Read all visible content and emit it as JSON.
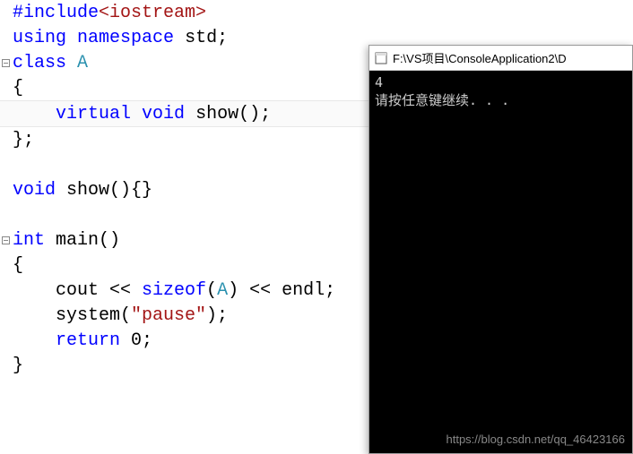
{
  "editor": {
    "lines": [
      {
        "fold": "",
        "tokens": [
          {
            "t": "#include",
            "c": "preproc"
          },
          {
            "t": "<iostream>",
            "c": "angle"
          }
        ]
      },
      {
        "fold": "",
        "tokens": [
          {
            "t": "using",
            "c": "kw-blue"
          },
          {
            "t": " ",
            "c": "txt"
          },
          {
            "t": "namespace",
            "c": "kw-blue"
          },
          {
            "t": " std;",
            "c": "txt"
          }
        ]
      },
      {
        "fold": "minus",
        "tokens": [
          {
            "t": "class",
            "c": "kw-blue"
          },
          {
            "t": " ",
            "c": "txt"
          },
          {
            "t": "A",
            "c": "kw-teal"
          }
        ]
      },
      {
        "fold": "",
        "tokens": [
          {
            "t": "{",
            "c": "txt"
          }
        ]
      },
      {
        "fold": "",
        "highlight": true,
        "tokens": [
          {
            "t": "    ",
            "c": "txt"
          },
          {
            "t": "virtual",
            "c": "kw-blue"
          },
          {
            "t": " ",
            "c": "txt"
          },
          {
            "t": "void",
            "c": "kw-blue"
          },
          {
            "t": " show();",
            "c": "txt"
          }
        ]
      },
      {
        "fold": "",
        "tokens": [
          {
            "t": "};",
            "c": "txt"
          }
        ]
      },
      {
        "fold": "",
        "tokens": []
      },
      {
        "fold": "",
        "tokens": [
          {
            "t": "void",
            "c": "kw-blue"
          },
          {
            "t": " show(){}",
            "c": "txt"
          }
        ]
      },
      {
        "fold": "",
        "tokens": []
      },
      {
        "fold": "minus",
        "tokens": [
          {
            "t": "int",
            "c": "kw-blue"
          },
          {
            "t": " main()",
            "c": "txt"
          }
        ]
      },
      {
        "fold": "",
        "tokens": [
          {
            "t": "{",
            "c": "txt"
          }
        ]
      },
      {
        "fold": "",
        "tokens": [
          {
            "t": "    cout << ",
            "c": "txt"
          },
          {
            "t": "sizeof",
            "c": "kw-blue"
          },
          {
            "t": "(",
            "c": "txt"
          },
          {
            "t": "A",
            "c": "kw-teal"
          },
          {
            "t": ") << endl;",
            "c": "txt"
          }
        ]
      },
      {
        "fold": "",
        "tokens": [
          {
            "t": "    system(",
            "c": "txt"
          },
          {
            "t": "\"pause\"",
            "c": "str-red"
          },
          {
            "t": ");",
            "c": "txt"
          }
        ]
      },
      {
        "fold": "",
        "tokens": [
          {
            "t": "    ",
            "c": "txt"
          },
          {
            "t": "return",
            "c": "kw-blue"
          },
          {
            "t": " 0;",
            "c": "txt"
          }
        ]
      },
      {
        "fold": "",
        "tokens": [
          {
            "t": "}",
            "c": "txt"
          }
        ]
      }
    ]
  },
  "console": {
    "title": "F:\\VS项目\\ConsoleApplication2\\D",
    "output": [
      "4",
      "请按任意键继续. . ."
    ]
  },
  "watermark": "https://blog.csdn.net/qq_46423166"
}
